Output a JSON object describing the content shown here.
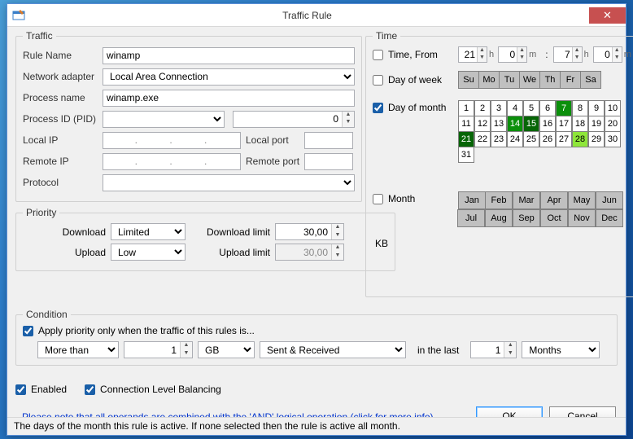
{
  "window": {
    "title": "Traffic Rule"
  },
  "traffic": {
    "legend": "Traffic",
    "rule_name_label": "Rule Name",
    "rule_name": "winamp",
    "adapter_label": "Network adapter",
    "adapter": "Local Area Connection",
    "process_label": "Process name",
    "process": "winamp.exe",
    "pid_label": "Process ID (PID)",
    "pid_value": "0",
    "local_ip_label": "Local IP",
    "local_ip": "   .       .       .   ",
    "local_port_label": "Local port",
    "local_port": "",
    "remote_ip_label": "Remote IP",
    "remote_ip": "   .       .       .   ",
    "remote_port_label": "Remote port",
    "remote_port": "",
    "protocol_label": "Protocol"
  },
  "priority": {
    "legend": "Priority",
    "download_label": "Download",
    "download_value": "Limited",
    "upload_label": "Upload",
    "upload_value": "Low",
    "dl_limit_label": "Download limit",
    "dl_limit": "30,00",
    "ul_limit_label": "Upload limit",
    "ul_limit": "30,00",
    "unit": "KB"
  },
  "time": {
    "legend": "Time",
    "from_label": "Time, From",
    "from_h": "21",
    "from_m": "0",
    "to_h": "7",
    "to_m": "0",
    "h_unit": "h",
    "m_unit": "m",
    "colon": ":",
    "dow_label": "Day of week",
    "dow": [
      "Su",
      "Mo",
      "Tu",
      "We",
      "Th",
      "Fr",
      "Sa"
    ],
    "dom_label": "Day of month",
    "dom_selected_dark": [
      7,
      14
    ],
    "dom_selected_darker": [
      15,
      21
    ],
    "dom_selected_light": [
      28
    ],
    "month_label": "Month",
    "months": [
      "Jan",
      "Feb",
      "Mar",
      "Apr",
      "May",
      "Jun",
      "Jul",
      "Aug",
      "Sep",
      "Oct",
      "Nov",
      "Dec"
    ]
  },
  "condition": {
    "legend": "Condition",
    "apply_label": "Apply priority only when the traffic of this rules is...",
    "op": "More than",
    "amount": "1",
    "unit": "GB",
    "direction": "Sent & Received",
    "in_last_label": "in the last",
    "period_n": "1",
    "period_unit": "Months"
  },
  "bottom": {
    "enabled": "Enabled",
    "clb": "Connection Level Balancing",
    "note": "Please note that all operands are combined with the 'AND' logical operation (click for more info)",
    "ok": "OK",
    "cancel": "Cancel"
  },
  "status": "The days of the month this rule is active. If none selected then the rule is active all month."
}
